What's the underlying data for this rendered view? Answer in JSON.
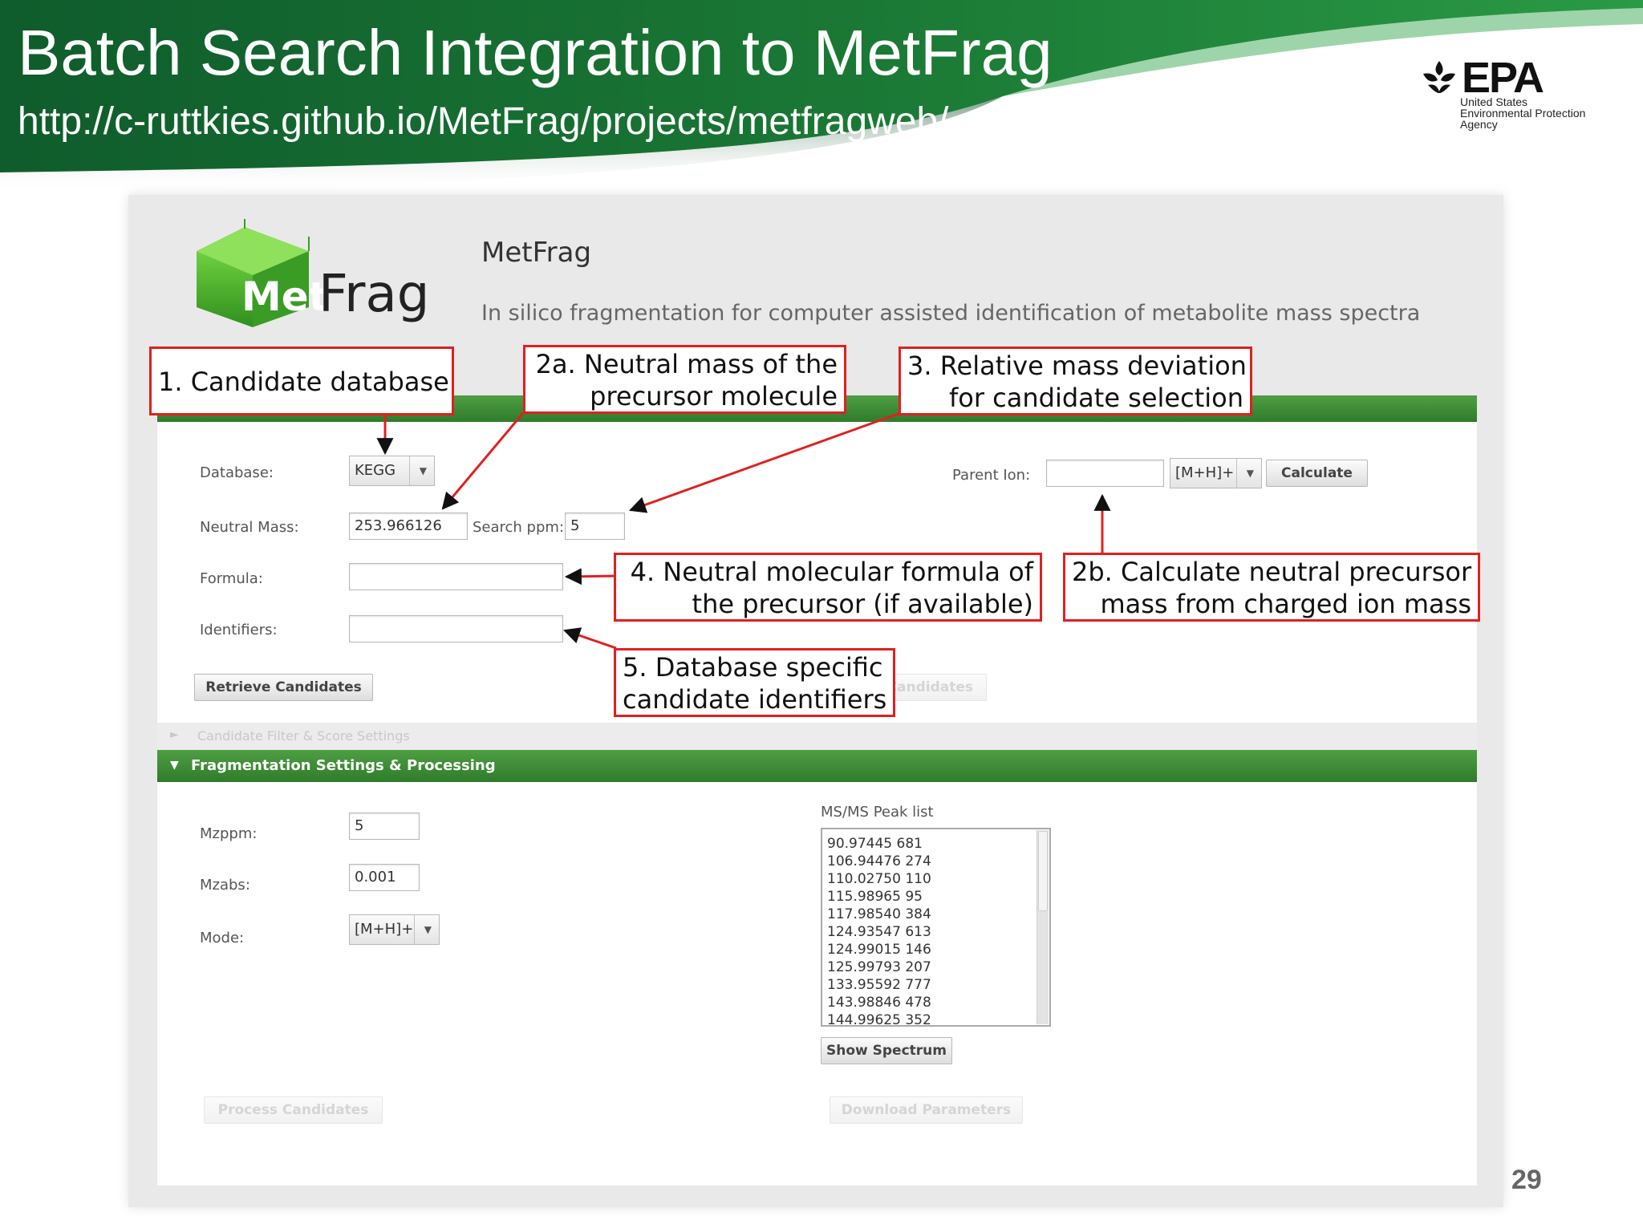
{
  "slide": {
    "title": "Batch Search Integration to MetFrag",
    "url": "http://c-ruttkies.github.io/MetFrag/projects/metfragweb/",
    "page_number": "29",
    "logo": {
      "name": "EPA",
      "line1": "United States",
      "line2": "Environmental Protection",
      "line3": "Agency"
    }
  },
  "app": {
    "logo_text_left": "Met",
    "logo_text_right": "Frag",
    "title": "MetFrag",
    "subtitle": "In silico fragmentation for computer assisted identification of metabolite mass spectra",
    "candidate_section": {
      "database_label": "Database:",
      "database_value": "KEGG",
      "neutral_mass_label": "Neutral Mass:",
      "neutral_mass_value": "253.966126",
      "search_ppm_label": "Search ppm:",
      "search_ppm_value": "5",
      "formula_label": "Formula:",
      "formula_value": "",
      "identifiers_label": "Identifiers:",
      "identifiers_value": "",
      "parent_ion_label": "Parent Ion:",
      "parent_ion_value": "",
      "parent_ion_mode": "[M+H]+",
      "calculate_button": "Calculate",
      "retrieve_button": "Retrieve Candidates",
      "download_candidates_button_partial": "ad Candidates"
    },
    "filter_section": {
      "label": "Candidate Filter & Score Settings"
    },
    "fragmentation_section": {
      "label": "Fragmentation Settings & Processing",
      "mzppm_label": "Mzppm:",
      "mzppm_value": "5",
      "mzabs_label": "Mzabs:",
      "mzabs_value": "0.001",
      "mode_label": "Mode:",
      "mode_value": "[M+H]+",
      "peaklist_label": "MS/MS Peak list",
      "peaks": [
        "90.97445 681",
        "106.94476 274",
        "110.02750 110",
        "115.98965 95",
        "117.98540 384",
        "124.93547 613",
        "124.99015 146",
        "125.99793 207",
        "133.95592 777",
        "143.98846 478",
        "144.99625 352"
      ],
      "show_spectrum_button": "Show Spectrum",
      "process_button": "Process Candidates",
      "download_parameters_button": "Download Parameters"
    }
  },
  "callouts": {
    "c1": [
      "1. Candidate database"
    ],
    "c2a": [
      "2a. Neutral mass of the",
      "precursor molecule"
    ],
    "c3": [
      "3. Relative mass deviation",
      "for candidate selection"
    ],
    "c4": [
      "4. Neutral molecular formula of",
      "the precursor (if available)"
    ],
    "c2b": [
      "2b. Calculate neutral precursor",
      "mass from charged ion mass"
    ],
    "c5": [
      "5. Database specific",
      "candidate identifiers"
    ]
  },
  "colors": {
    "banner_green": "#1f7a35",
    "panel_green": "#3f8f3a",
    "callout_red": "#e02020"
  }
}
